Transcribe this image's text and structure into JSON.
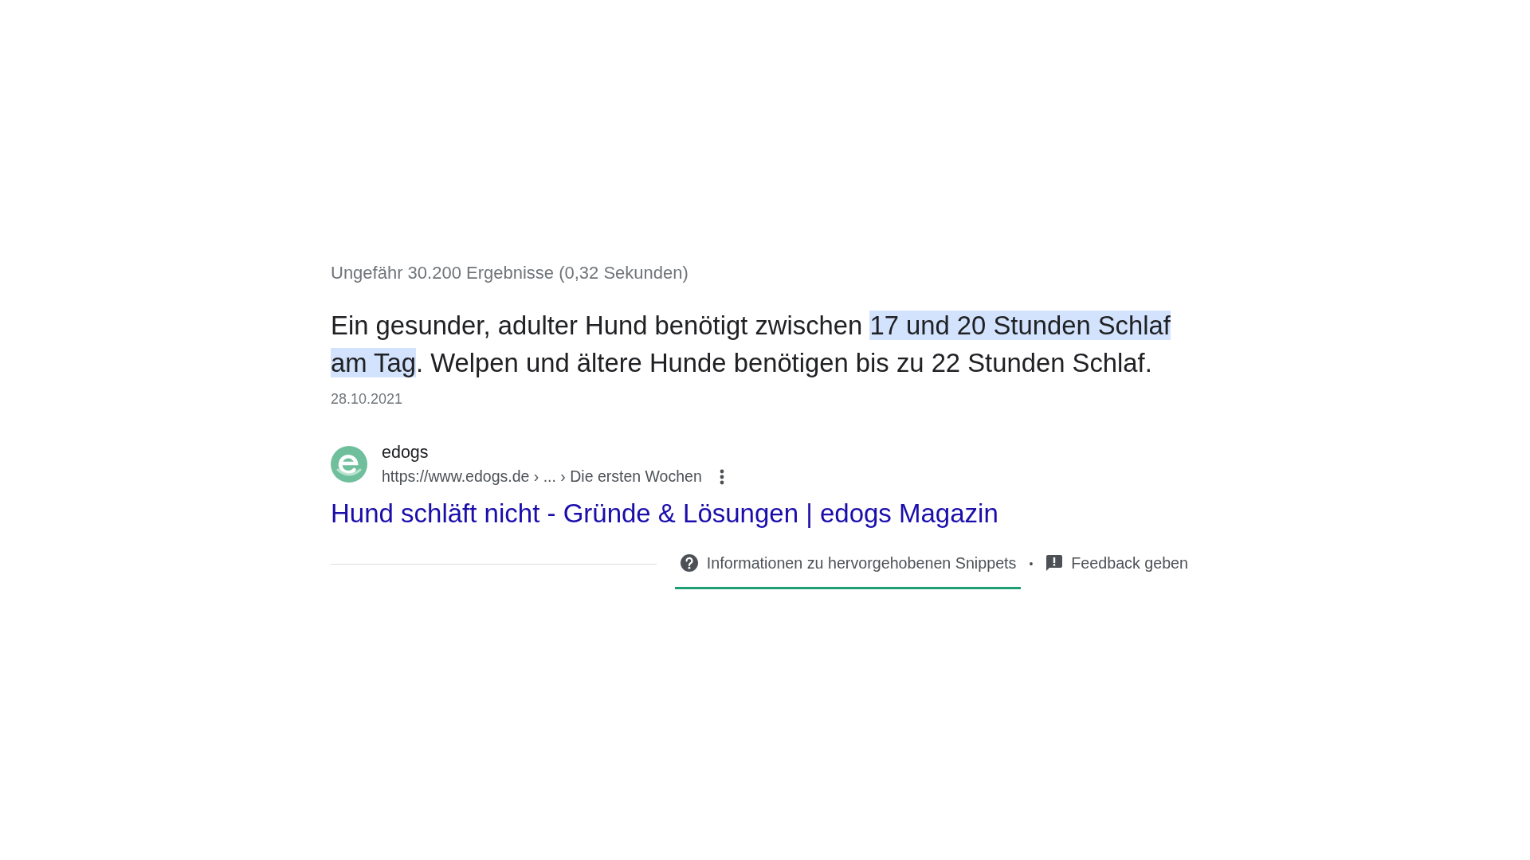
{
  "result_stats": "Ungefähr 30.200 Ergebnisse (0,32 Sekunden)",
  "featured_snippet": {
    "answer": [
      {
        "text": "Ein gesunder, adulter Hund benötigt zwischen ",
        "highlighted": false
      },
      {
        "text": "17 und 20 Stunden Schlaf am Tag",
        "highlighted": true
      },
      {
        "text": ". Welpen und ältere Hunde benötigen bis zu 22 Stunden Schlaf.",
        "highlighted": false
      }
    ],
    "date": "28.10.2021",
    "source": {
      "site_name": "edogs",
      "url": "https://www.edogs.de › ... › Die ersten Wochen",
      "title": "Hund schläft nicht - Gründe & Lösungen | edogs Magazin"
    }
  },
  "footer": {
    "links": [
      {
        "kind": "about",
        "label": "Informationen zu hervorgehobenen Snippets",
        "underlined": true
      },
      {
        "kind": "feedback",
        "label": "Feedback geben",
        "underlined": false
      }
    ],
    "separator": "•"
  }
}
